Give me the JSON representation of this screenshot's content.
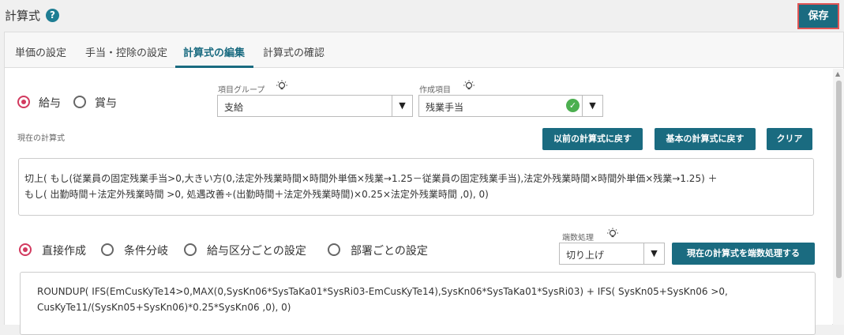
{
  "header": {
    "title": "計算式",
    "help_icon": "?",
    "save_label": "保存"
  },
  "tabs": [
    {
      "label": "単価の設定"
    },
    {
      "label": "手当・控除の設定"
    },
    {
      "label": "計算式の編集"
    },
    {
      "label": "計算式の確認"
    }
  ],
  "active_tab_index": 2,
  "pay_type": {
    "options": [
      "給与",
      "賞与"
    ],
    "selected": "給与"
  },
  "item_group": {
    "label": "項目グループ",
    "value": "支給"
  },
  "created_item": {
    "label": "作成項目",
    "value": "残業手当"
  },
  "current_formula": {
    "label": "現在の計算式",
    "buttons": {
      "revert_prev": "以前の計算式に戻す",
      "revert_basic": "基本の計算式に戻す",
      "clear": "クリア"
    },
    "line1": "切上( もし(従業員の固定残業手当>0,大きい方(0,法定外残業時間×時間外単価×残業→1.25－従業員の固定残業手当),法定外残業時間×時間外単価×残業→1.25) ＋",
    "line2": "もし( 出勤時間＋法定外残業時間 >0,  処遇改善÷(出勤時間＋法定外残業時間)×0.25×法定外残業時間 ,0), 0)"
  },
  "mode": {
    "options": [
      "直接作成",
      "条件分岐",
      "給与区分ごとの設定",
      "部署ごとの設定"
    ],
    "selected": "直接作成"
  },
  "rounding": {
    "label": "端数処理",
    "value": "切り上げ",
    "apply_button": "現在の計算式を端数処理する"
  },
  "raw_formula": {
    "line1": "ROUNDUP( IFS(EmCusKyTe14>0,MAX(0,SysKn06*SysTaKa01*SysRi03-EmCusKyTe14),SysKn06*SysTaKa01*SysRi03) + IFS( SysKn05+SysKn06 >0,",
    "line2": "CusKyTe11/(SysKn05+SysKn06)*0.25*SysKn06 ,0), 0)"
  },
  "colors": {
    "accent": "#1a6b80",
    "radio": "#d23a5f",
    "check": "#4caf50",
    "save_border": "#e05555"
  }
}
